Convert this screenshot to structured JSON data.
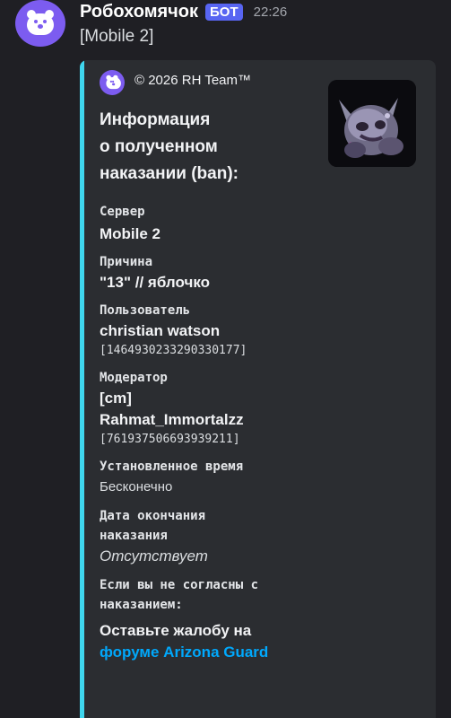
{
  "message": {
    "author": "Робохомячок",
    "badge": "БОТ",
    "timestamp": "22:26",
    "content": "[Mobile 2]"
  },
  "embed": {
    "accent_color": "#3fd6ee",
    "footer_text": "© 2026 RH Team™",
    "title_lines": [
      "Информация",
      "о полученном",
      "наказании (ban):"
    ],
    "fields": {
      "server": {
        "name": "Сервер",
        "value": "Mobile 2"
      },
      "reason": {
        "name": "Причина",
        "value": "\"13\" // яблочко"
      },
      "user": {
        "name": "Пользователь",
        "value": "christian watson",
        "id": "[1464930233290330177]"
      },
      "moderator": {
        "name": "Модератор",
        "value_line1": "[cm]",
        "value_line2": "Rahmat_Immortalzz",
        "id": "[761937506693939211]"
      },
      "duration": {
        "name": "Установленное время",
        "value": "Бесконечно"
      },
      "end_date": {
        "name_line1": "Дата окончания",
        "name_line2": "наказания",
        "value": "Отсутствует"
      },
      "appeal": {
        "name_line1": "Если вы не согласны с",
        "name_line2": "наказанием:",
        "value_line1": "Оставьте жалобу на",
        "link": "форуме Arizona Guard"
      }
    }
  },
  "icons": {
    "avatar": "hamster-avatar-icon",
    "footer": "hamster-footer-icon",
    "thumbnail": "creature-thumbnail-icon"
  }
}
